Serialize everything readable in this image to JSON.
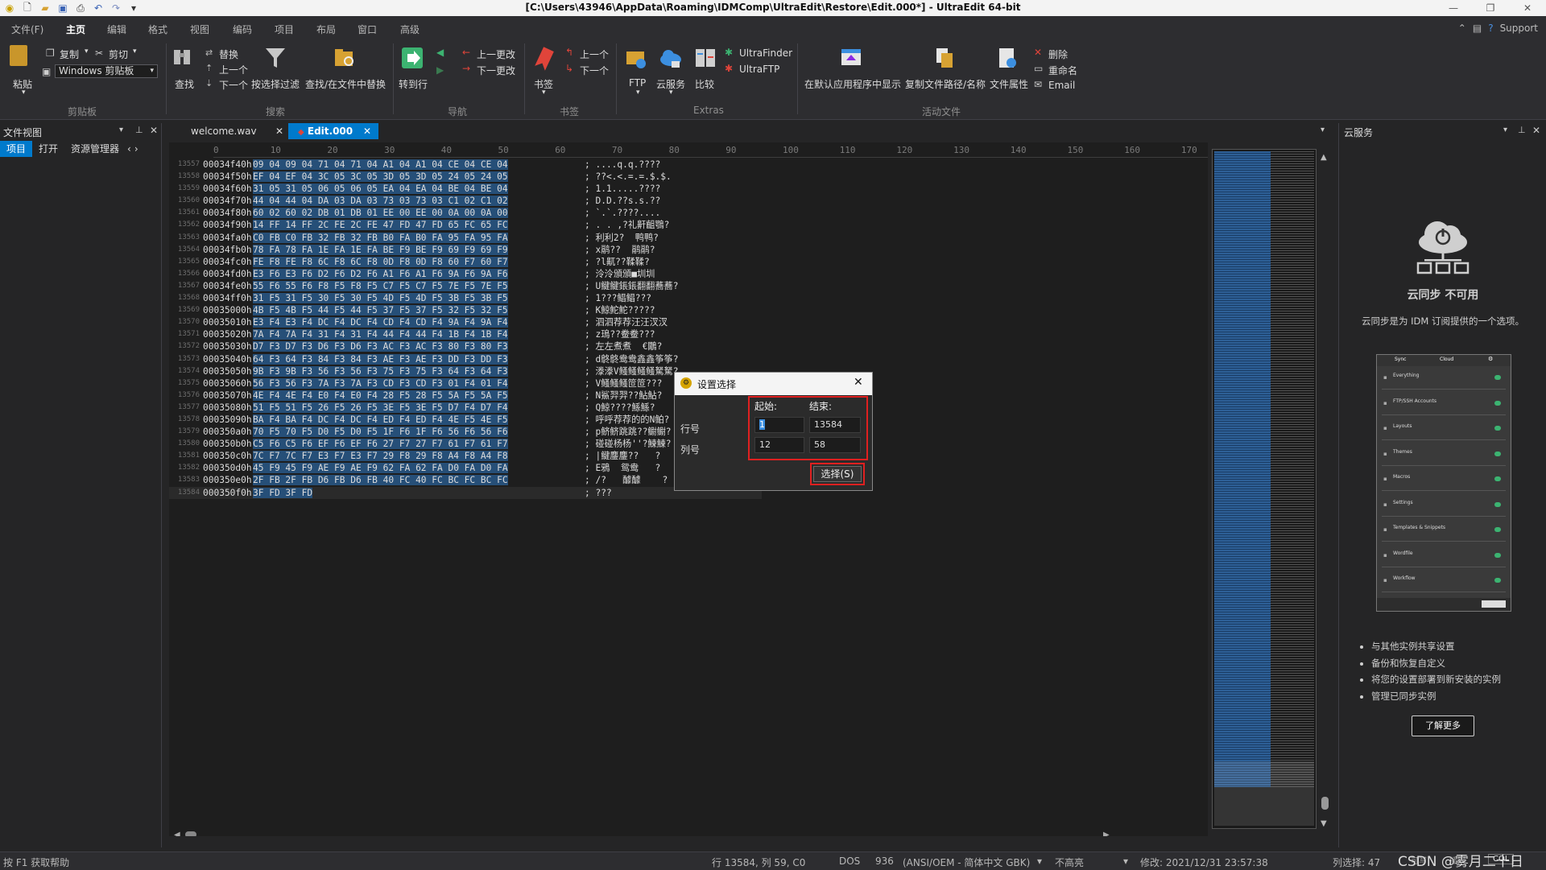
{
  "window": {
    "title": "[C:\\Users\\43946\\AppData\\Roaming\\IDMComp\\UltraEdit\\Restore\\Edit.000*] - UltraEdit 64-bit"
  },
  "menu": {
    "items": [
      "文件(F)",
      "主页",
      "编辑",
      "格式",
      "视图",
      "编码",
      "项目",
      "布局",
      "窗口",
      "高级"
    ],
    "active_index": 1,
    "support": "Support"
  },
  "ribbon": {
    "clipboard": {
      "paste": "粘贴",
      "copy": "复制",
      "cut": "剪切",
      "combo": "Windows 剪贴板",
      "group": "剪贴板"
    },
    "search": {
      "find": "查找",
      "replace": "替换",
      "prev": "上一个",
      "next": "下一个",
      "filter": "按选择过滤",
      "find_in_files": "查找/在文件中替换",
      "group": "搜索"
    },
    "navigation": {
      "goto": "转到行",
      "prev_change": "上一更改",
      "next_change": "下一更改",
      "group": "导航"
    },
    "bookmarks": {
      "bookmark": "书签",
      "prev": "上一个",
      "next": "下一个",
      "group": "书签"
    },
    "extras": {
      "ftp": "FTP",
      "cloud": "云服务",
      "compare": "比较",
      "finder": "UltraFinder",
      "ultraftp": "UltraFTP",
      "group": "Extras"
    },
    "active_file": {
      "show_default": "在默认应用程序中显示",
      "copy_path": "复制文件路径/名称",
      "properties": "文件属性",
      "delete": "删除",
      "rename": "重命名",
      "email": "Email",
      "group": "活动文件"
    }
  },
  "left_panel": {
    "title": "文件视图",
    "tabs": [
      "项目",
      "打开",
      "资源管理器"
    ]
  },
  "tabs": [
    {
      "label": "welcome.wav",
      "active": false
    },
    {
      "label": "Edit.000",
      "active": true
    }
  ],
  "ruler": [
    "0",
    "10",
    "20",
    "30",
    "40",
    "50",
    "60",
    "70",
    "80",
    "90",
    "100",
    "110",
    "120",
    "130",
    "140",
    "150",
    "160",
    "170"
  ],
  "hex_lines": [
    {
      "no": "13557",
      "addr": "00034f40h:",
      "hex": "09 04 09 04 71 04 71 04 A1 04 A1 04 CE 04 CE 04",
      "ascii": "; ....q.q.????"
    },
    {
      "no": "13558",
      "addr": "00034f50h:",
      "hex": "EF 04 EF 04 3C 05 3C 05 3D 05 3D 05 24 05 24 05",
      "ascii": "; ??<.<.=.=.$.$."
    },
    {
      "no": "13559",
      "addr": "00034f60h:",
      "hex": "31 05 31 05 06 05 06 05 EA 04 EA 04 BE 04 BE 04",
      "ascii": "; 1.1.....????"
    },
    {
      "no": "13560",
      "addr": "00034f70h:",
      "hex": "44 04 44 04 DA 03 DA 03 73 03 73 03 C1 02 C1 02",
      "ascii": "; D.D.??s.s.??"
    },
    {
      "no": "13561",
      "addr": "00034f80h:",
      "hex": "60 02 60 02 DB 01 DB 01 EE 00 EE 00 0A 00 0A 00",
      "ascii": "; `.`.????...."
    },
    {
      "no": "13562",
      "addr": "00034f90h:",
      "hex": "14 FF 14 FF 2C FE 2C FE 47 FD 47 FD 65 FC 65 FC",
      "ascii": "; . . ,?礼鼾齟鶚?"
    },
    {
      "no": "13563",
      "addr": "00034fa0h:",
      "hex": "C0 FB C0 FB 32 FB 32 FB B0 FA B0 FA 95 FA 95 FA",
      "ascii": "; 利利2?  鸭鸭?"
    },
    {
      "no": "13564",
      "addr": "00034fb0h:",
      "hex": "78 FA 78 FA 1E FA 1E FA BE F9 BE F9 69 F9 69 F9",
      "ascii": "; x鹝??  鹝鹝?"
    },
    {
      "no": "13565",
      "addr": "00034fc0h:",
      "hex": "FE F8 FE F8 6C F8 6C F8 0D F8 0D F8 60 F7 60 F7",
      "ascii": "; ?l鼿??鞣鞣?"
    },
    {
      "no": "13566",
      "addr": "00034fd0h:",
      "hex": "E3 F6 E3 F6 D2 F6 D2 F6 A1 F6 A1 F6 9A F6 9A F6",
      "ascii": "; 泠泠頒頒■圳圳"
    },
    {
      "no": "13567",
      "addr": "00034fe0h:",
      "hex": "55 F6 55 F6 F8 F5 F8 F5 C7 F5 C7 F5 7E F5 7E F5",
      "ascii": "; U鰎鰎鋹鋹翻翻蕎蕎?"
    },
    {
      "no": "13568",
      "addr": "00034ff0h:",
      "hex": "31 F5 31 F5 30 F5 30 F5 4D F5 4D F5 3B F5 3B F5",
      "ascii": "; 1???鲳鲳???"
    },
    {
      "no": "13569",
      "addr": "00035000h:",
      "hex": "4B F5 4B F5 44 F5 44 F5 37 F5 37 F5 32 F5 32 F5",
      "ascii": "; K鯨鮀鮀?????"
    },
    {
      "no": "13570",
      "addr": "00035010h:",
      "hex": "E3 F4 E3 F4 DC F4 DC F4 CD F4 CD F4 9A F4 9A F4",
      "ascii": "; 泗泗荐荐汪汪汊汊"
    },
    {
      "no": "13571",
      "addr": "00035020h:",
      "hex": "7A F4 7A F4 31 F4 31 F4 44 F4 44 F4 1B F4 1B F4",
      "ascii": "; z鳿??鲞鲞???"
    },
    {
      "no": "13572",
      "addr": "00035030h:",
      "hex": "D7 F3 D7 F3 D6 F3 D6 F3 AC F3 AC F3 80 F3 80 F3",
      "ascii": "; 左左煮煮  €鷳?"
    },
    {
      "no": "13573",
      "addr": "00035040h:",
      "hex": "64 F3 64 F3 84 F3 84 F3 AE F3 AE F3 DD F3 DD F3",
      "ascii": "; d鴤鴤鸯鸯鑫鑫筝筝?"
    },
    {
      "no": "13574",
      "addr": "00035050h:",
      "hex": "9B F3 9B F3 56 F3 56 F3 75 F3 75 F3 64 F3 64 F3",
      "ascii": "; 漛漛V鳋鳋鳋鳋駑駑?"
    },
    {
      "no": "13575",
      "addr": "00035060h:",
      "hex": "56 F3 56 F3 7A F3 7A F3 CD F3 CD F3 01 F4 01 F4",
      "ascii": "; V鳋鳋鳋笸笸???"
    },
    {
      "no": "13576",
      "addr": "00035070h:",
      "hex": "4E F4 4E F4 E0 F4 E0 F4 28 F5 28 F5 5A F5 5A F5",
      "ascii": "; N鯊羿羿??鮎鮎?"
    },
    {
      "no": "13577",
      "addr": "00035080h:",
      "hex": "51 F5 51 F5 26 F5 26 F5 3E F5 3E F5 D7 F4 D7 F4",
      "ascii": "; Q鯨????鯀鯀?"
    },
    {
      "no": "13578",
      "addr": "00035090h:",
      "hex": "BA F4 BA F4 DC F4 DC F4 ED F4 ED F4 4E F5 4E F5",
      "ascii": "; 呼呼荐荐的的N鲌?"
    },
    {
      "no": "13579",
      "addr": "000350a0h:",
      "hex": "70 F5 70 F5 D0 F5 D0 F5 1F F6 1F F6 56 F6 56 F6",
      "ascii": "; p鲚鲚跳跳??鳚鳚?"
    },
    {
      "no": "13580",
      "addr": "000350b0h:",
      "hex": "C5 F6 C5 F6 EF F6 EF F6 27 F7 27 F7 61 F7 61 F7",
      "ascii": "; 碰碰杨杨''?鰊鰊?"
    },
    {
      "no": "13581",
      "addr": "000350c0h:",
      "hex": "7C F7 7C F7 E3 F7 E3 F7 29 F8 29 F8 A4 F8 A4 F8",
      "ascii": "; |鰎鏖鏖??   ?"
    },
    {
      "no": "13582",
      "addr": "000350d0h:",
      "hex": "45 F9 45 F9 AE F9 AE F9 62 FA 62 FA D0 FA D0 FA",
      "ascii": "; E鴉  鸳鸯   ?"
    },
    {
      "no": "13583",
      "addr": "000350e0h:",
      "hex": "2F FB 2F FB D6 FB D6 FB 40 FC 40 FC BC FC BC FC",
      "ascii": "; /?   醵醵    ?"
    },
    {
      "no": "13584",
      "addr": "000350f0h:",
      "hex": "3F FD 3F FD",
      "ascii": "; ???"
    }
  ],
  "right_panel": {
    "title": "云服务",
    "heading": "云同步 不可用",
    "subtext": "云同步是为 IDM 订阅提供的一个选项。",
    "preview_tabs": [
      "Sync",
      "Cloud"
    ],
    "preview_rows": [
      "Everything",
      "FTP/SSH Accounts",
      "Layouts",
      "Themes",
      "Macros",
      "Settings",
      "Templates & Snippets",
      "Wordfile",
      "Workflow"
    ],
    "bullets": [
      "与其他实例共享设置",
      "备份和恢复自定义",
      "将您的设置部署到新安装的实例",
      "管理已同步实例"
    ],
    "learn_more": "了解更多"
  },
  "dialog": {
    "title": "设置选择",
    "start_label": "起始:",
    "end_label": "结束:",
    "row_label": "行号",
    "col_label": "列号",
    "row_start": "1",
    "row_end": "13584",
    "col_start": "12",
    "col_end": "58",
    "select_button": "选择(S)"
  },
  "status": {
    "help": "按 F1 获取帮助",
    "position": "行 13584, 列 59, C0",
    "line_ending": "DOS",
    "codepage": "936",
    "encoding": "(ANSI/OEM - 简体中文 GBK)",
    "highlight": "不高亮",
    "modified": "修改: 2021/12/31 23:57:38",
    "col_select": "列选择: 47",
    "watermark": "CSDN @雾月二十日",
    "mode_rw": "可写",
    "mode_ins": "插入",
    "mode_col": "COL"
  },
  "colors": {
    "accent": "#007acc",
    "selection": "#264f78",
    "highlight_red": "#e02020"
  }
}
